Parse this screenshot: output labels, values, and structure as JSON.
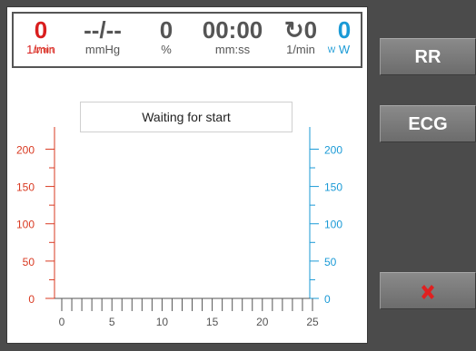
{
  "header": {
    "metrics": [
      {
        "value": "0",
        "unit": "1/min",
        "color": "red"
      },
      {
        "value": "--/--",
        "unit": "mmHg",
        "color": "gray"
      },
      {
        "value": "0",
        "unit": "%",
        "color": "gray"
      },
      {
        "value": "00:00",
        "unit": "mm:ss",
        "color": "gray"
      },
      {
        "value": "↻0",
        "unit": "1/min",
        "color": "gray"
      },
      {
        "value": "0",
        "unit": "W",
        "color": "blue"
      }
    ]
  },
  "status": "Waiting for start",
  "buttons": {
    "rr": "RR",
    "ecg": "ECG",
    "close_icon": "close-x-icon"
  },
  "colors": {
    "left_axis": "#d93a22",
    "right_axis": "#1a9ad6",
    "bottom_axis": "#555555",
    "close": "#e02020"
  },
  "chart_data": {
    "type": "line",
    "left_axis": {
      "label": "1/min",
      "ticks": [
        "0",
        "50",
        "100",
        "150",
        "200"
      ],
      "range": [
        0,
        220
      ]
    },
    "right_axis": {
      "label": "W",
      "ticks": [
        "0",
        "50",
        "100",
        "150",
        "200"
      ],
      "range": [
        0,
        220
      ]
    },
    "x_axis": {
      "ticks": [
        "0",
        "5",
        "10",
        "15",
        "20",
        "25"
      ],
      "range": [
        0,
        25
      ]
    },
    "series": []
  }
}
